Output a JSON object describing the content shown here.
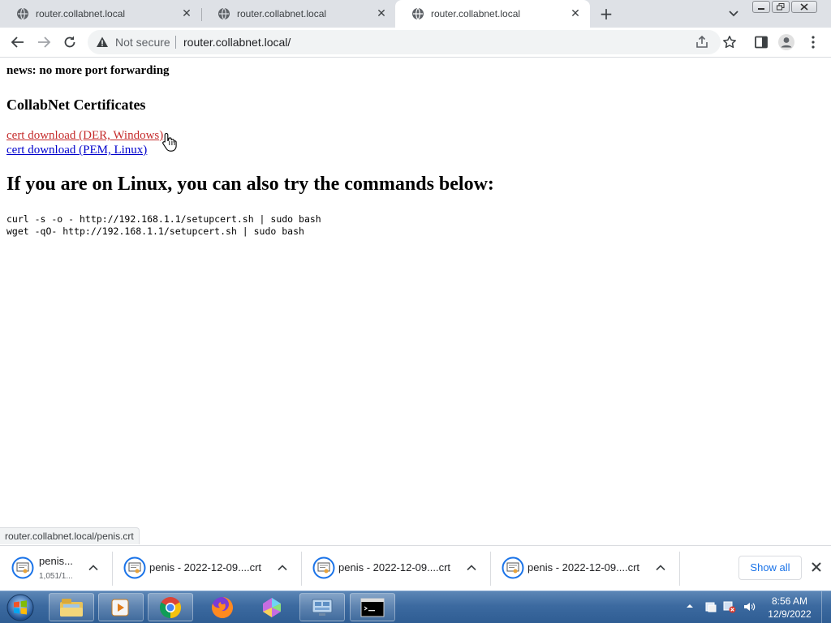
{
  "browser": {
    "tabs": [
      {
        "title": "router.collabnet.local",
        "active": false
      },
      {
        "title": "router.collabnet.local",
        "active": false
      },
      {
        "title": "router.collabnet.local",
        "active": true
      }
    ],
    "omnibox": {
      "security_label": "Not secure",
      "url": "router.collabnet.local/"
    },
    "status_url": "router.collabnet.local/penis.crt"
  },
  "page": {
    "news": "news: no more port forwarding",
    "certs_heading": "CollabNet Certificates",
    "links": {
      "der": "cert download (DER, Windows)",
      "pem": "cert download (PEM, Linux)"
    },
    "linux_heading": "If you are on Linux, you can also try the commands below:",
    "commands": [
      "curl -s -o - http://192.168.1.1/setupcert.sh | sudo bash",
      "wget -qO- http://192.168.1.1/setupcert.sh | sudo bash"
    ]
  },
  "downloads": {
    "items": [
      {
        "name": "penis...",
        "sub": "1,051/1..."
      },
      {
        "name": "penis - 2022-12-09....crt"
      },
      {
        "name": "penis - 2022-12-09....crt"
      },
      {
        "name": "penis - 2022-12-09....crt"
      }
    ],
    "show_all_label": "Show all"
  },
  "taskbar": {
    "time": "8:56 AM",
    "date": "12/9/2022"
  },
  "colors": {
    "visited_link": "#c52c2c",
    "link": "#0000cc",
    "show_all": "#1a73e8"
  }
}
